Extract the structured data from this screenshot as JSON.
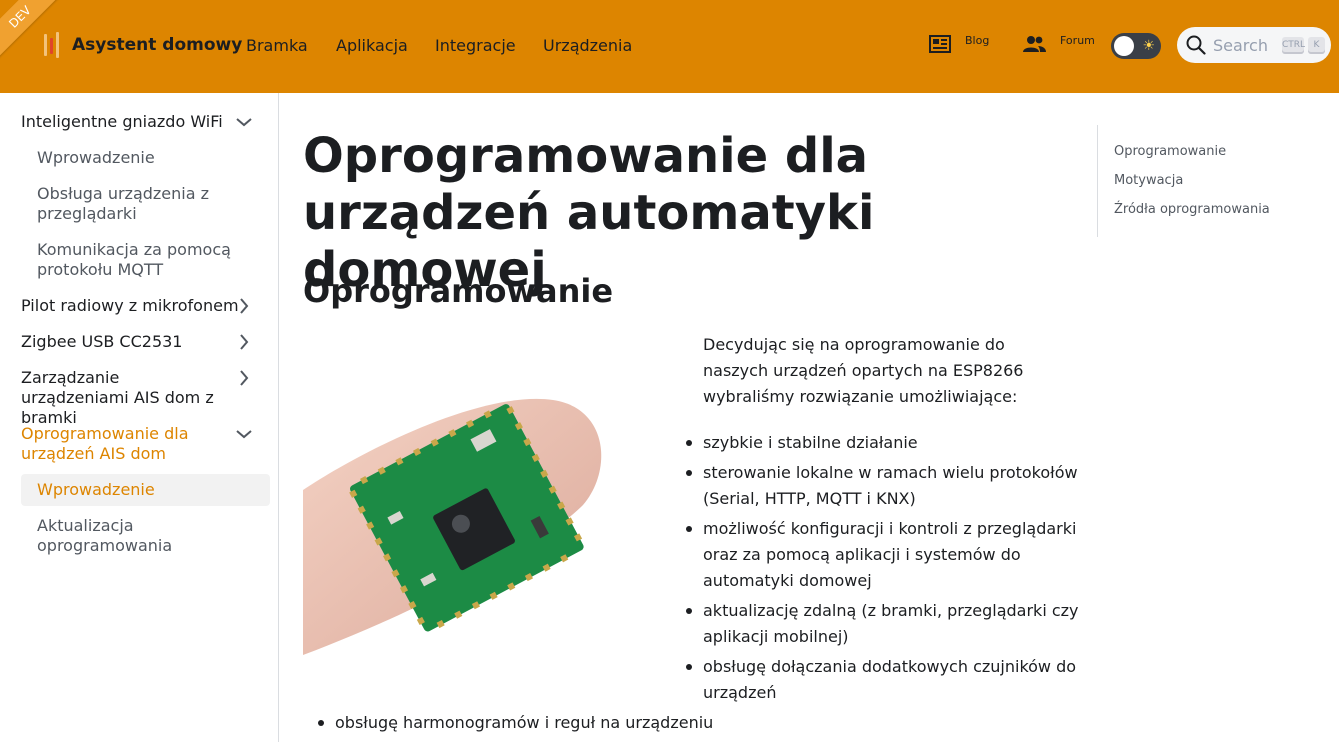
{
  "env_badge": "DEV",
  "brand": {
    "title": "Asystent domowy"
  },
  "nav": {
    "items": [
      "Bramka",
      "Aplikacja",
      "Integracje",
      "Urządzenia"
    ],
    "blog_label": "Blog",
    "forum_label": "Forum",
    "search_placeholder": "Search",
    "search_keys": [
      "CTRL",
      "K"
    ]
  },
  "sidebar": {
    "group1": {
      "label": "Inteligentne gniazdo WiFi",
      "children": [
        "Wprowadzenie",
        "Obsługa urządzenia z przeglądarki",
        "Komunikacja za pomocą protokołu MQTT"
      ]
    },
    "group2": "Pilot radiowy z mikrofonem",
    "group3": "Zigbee USB CC2531",
    "group4": "Zarządzanie urządzeniami AIS dom z bramki",
    "group5": {
      "label": "Oprogramowanie dla urządzeń AIS dom",
      "children": [
        "Wprowadzenie",
        "Aktualizacja oprogramowania"
      ]
    }
  },
  "main": {
    "title": "Oprogramowanie dla urządzeń automatyki domowej",
    "section_title": "Oprogramowanie",
    "intro": "Decydując się na oprogramowanie do naszych urządzeń opartych na ESP8266 wybraliśmy rozwiązanie umożliwiające:",
    "bullets": [
      "szybkie i stabilne działanie",
      "sterowanie lokalne w ramach wielu protokołów (Serial, HTTP, MQTT i KNX)",
      "możliwość konfiguracji i kontroli z przeglądarki oraz za pomocą aplikacji i systemów do automatyki domowej",
      "aktualizację zdalną (z bramki, przeglądarki czy aplikacji mobilnej)",
      "obsługę dołączania dodatkowych czujników do urządzeń"
    ],
    "last_bullet": "obsługę harmonogramów i reguł na urządzeniu"
  },
  "toc": [
    "Oprogramowanie",
    "Motywacja",
    "Źródła oprogramowania"
  ],
  "colors": {
    "primary": "#dd8500",
    "text": "#1c1e21"
  }
}
